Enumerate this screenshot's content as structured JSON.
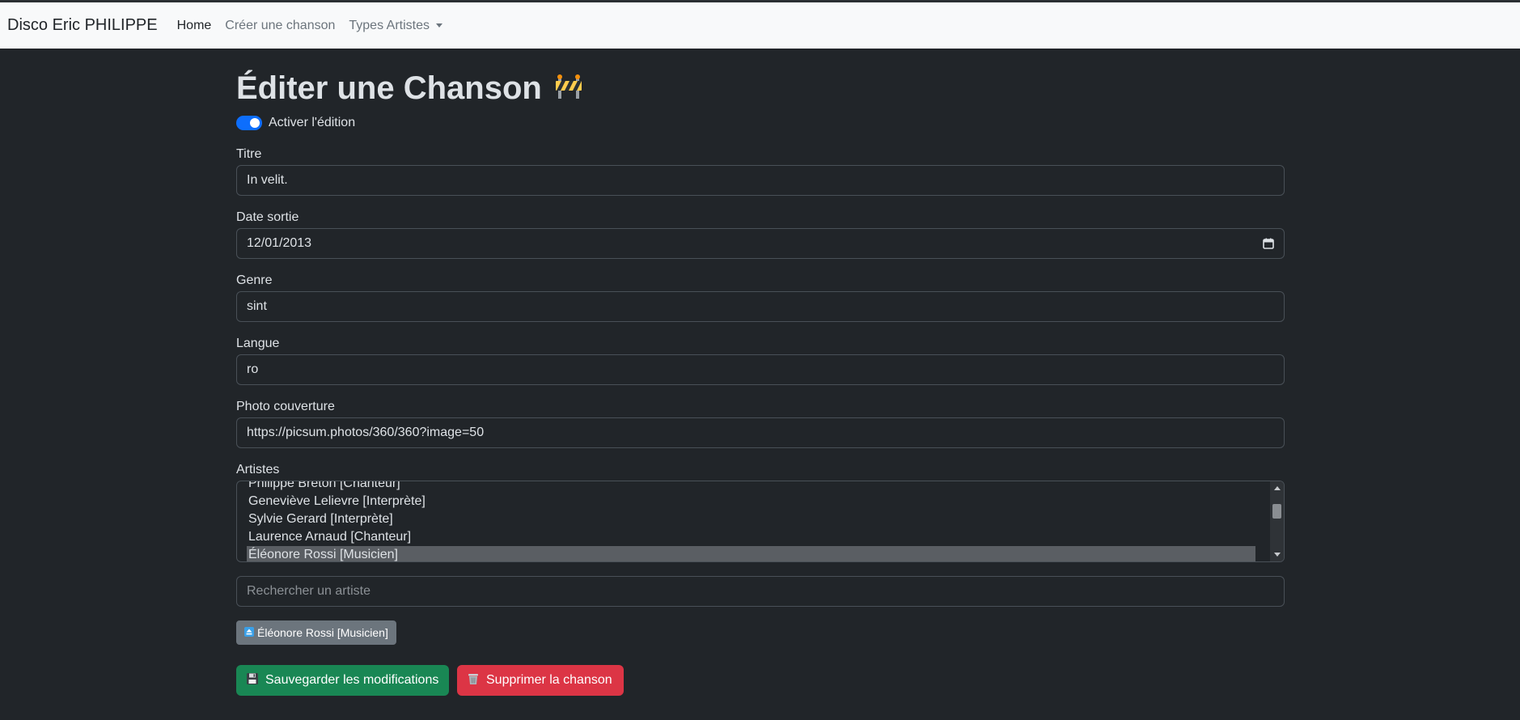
{
  "navbar": {
    "brand": "Disco Eric PHILIPPE",
    "links": [
      "Home",
      "Créer une chanson",
      "Types Artistes"
    ]
  },
  "page": {
    "title": "Éditer une Chanson",
    "title_icon": "construction-barrier-icon",
    "edit_toggle_label": "Activer l'édition",
    "edit_toggle_on": true
  },
  "form": {
    "titre_label": "Titre",
    "titre_value": "In velit.",
    "date_label": "Date sortie",
    "date_value": "12/01/2013",
    "genre_label": "Genre",
    "genre_value": "sint",
    "langue_label": "Langue",
    "langue_value": "ro",
    "photo_label": "Photo couverture",
    "photo_value": "https://picsum.photos/360/360?image=50",
    "artistes_label": "Artistes",
    "artistes_options": [
      "Philippe Breton [Chanteur]",
      "Geneviève Lelievre [Interprète]",
      "Sylvie Gerard [Interprète]",
      "Laurence Arnaud [Chanteur]",
      "Éléonore Rossi [Musicien]"
    ],
    "artistes_selected": "Éléonore Rossi [Musicien]",
    "search_placeholder": "Rechercher un artiste",
    "selected_chip": "Éléonore Rossi [Musicien]"
  },
  "actions": {
    "save_label": "Sauvegarder les modifications",
    "save_icon": "floppy-disk-icon",
    "delete_label": "Supprimer la chanson",
    "delete_icon": "wastebasket-icon"
  },
  "colors": {
    "background": "#212529",
    "navbar": "#f8f9fa",
    "primary": "#0d6efd",
    "success": "#198754",
    "danger": "#dc3545",
    "secondary": "#6c757d"
  }
}
